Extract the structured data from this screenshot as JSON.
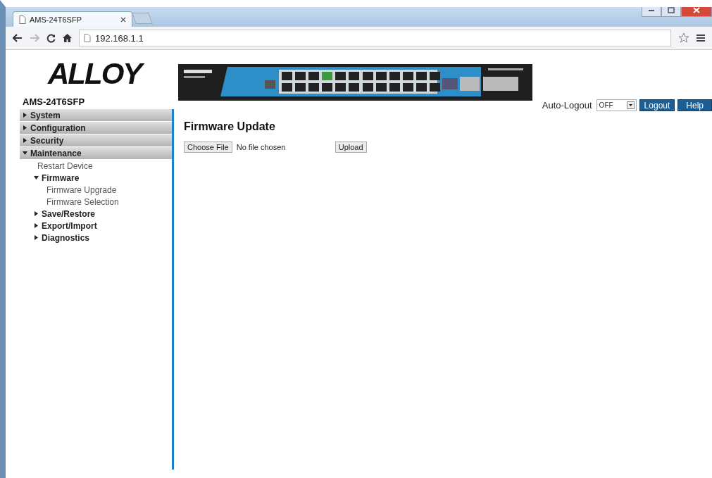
{
  "browser": {
    "tab_title": "AMS-24T6SFP",
    "address": "192.168.1.1"
  },
  "header": {
    "logo": "ALLOY",
    "model": "AMS-24T6SFP",
    "auto_logout_label": "Auto-Logout",
    "auto_logout_value": "OFF",
    "buttons": [
      "Logout",
      "Help"
    ]
  },
  "sidebar": {
    "items": [
      {
        "kind": "section",
        "label": "System",
        "expanded": false
      },
      {
        "kind": "section",
        "label": "Configuration",
        "expanded": false
      },
      {
        "kind": "section",
        "label": "Security",
        "expanded": false
      },
      {
        "kind": "section",
        "label": "Maintenance",
        "expanded": true,
        "children": [
          {
            "kind": "link",
            "label": "Restart Device"
          },
          {
            "kind": "folder",
            "label": "Firmware",
            "expanded": true,
            "children": [
              {
                "kind": "link",
                "label": "Firmware Upgrade"
              },
              {
                "kind": "link",
                "label": "Firmware Selection"
              }
            ]
          },
          {
            "kind": "folder",
            "label": "Save/Restore",
            "expanded": false
          },
          {
            "kind": "folder",
            "label": "Export/Import",
            "expanded": false
          },
          {
            "kind": "folder",
            "label": "Diagnostics",
            "expanded": false
          }
        ]
      }
    ]
  },
  "main": {
    "title": "Firmware Update",
    "file_button": "Choose File",
    "file_status": "No file chosen",
    "upload_button": "Upload"
  }
}
